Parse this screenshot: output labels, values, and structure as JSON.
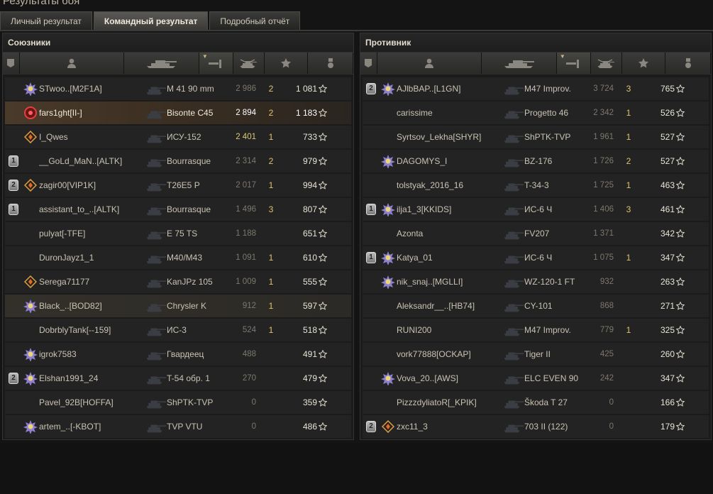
{
  "window": {
    "title": "Результаты боя"
  },
  "tabs": [
    {
      "label": "Личный результат",
      "active": false
    },
    {
      "label": "Командный результат",
      "active": true
    },
    {
      "label": "Подробный отчёт",
      "active": false
    }
  ],
  "teams": {
    "allies": {
      "title": "Союзники",
      "rows": [
        {
          "platoon": "",
          "icon": "medal-icon",
          "name": "STwoo..[M2F1A]",
          "vehicle": "M 41 90 mm",
          "damage": "2 986",
          "kills": "2",
          "xp": "1 081",
          "highlight": "",
          "dmg_hi": false
        },
        {
          "platoon": "",
          "icon": "clan-emblem-icon",
          "name": "fars1ght[II-]",
          "vehicle": "Bisonte C45",
          "damage": "2 894",
          "kills": "2",
          "xp": "1 183",
          "highlight": "self",
          "dmg_hi": true
        },
        {
          "platoon": "",
          "icon": "rank-icon",
          "name": "I_Qwes",
          "vehicle": "ИСУ-152",
          "damage": "2 401",
          "kills": "1",
          "xp": "733",
          "highlight": "",
          "dmg_hi": true
        },
        {
          "platoon": "1",
          "icon": "",
          "name": "__GoLd_MaN..[ALTK]",
          "vehicle": "Bourrasque",
          "damage": "2 314",
          "kills": "2",
          "xp": "979",
          "highlight": "",
          "dmg_hi": false
        },
        {
          "platoon": "2",
          "icon": "rank-icon",
          "name": "zagir00[VIP1K]",
          "vehicle": "T26E5 P",
          "damage": "2 017",
          "kills": "1",
          "xp": "994",
          "highlight": "",
          "dmg_hi": false
        },
        {
          "platoon": "1",
          "icon": "",
          "name": "assistant_to_..[ALTK]",
          "vehicle": "Bourrasque",
          "damage": "1 496",
          "kills": "3",
          "xp": "807",
          "highlight": "",
          "dmg_hi": false
        },
        {
          "platoon": "",
          "icon": "",
          "name": "pulyat[-TFE]",
          "vehicle": "E 75 TS",
          "damage": "1 188",
          "kills": "",
          "xp": "651",
          "highlight": "",
          "dmg_hi": false
        },
        {
          "platoon": "",
          "icon": "",
          "name": "DuronJayz1_1",
          "vehicle": "M40/M43",
          "damage": "1 091",
          "kills": "1",
          "xp": "610",
          "highlight": "",
          "dmg_hi": false
        },
        {
          "platoon": "",
          "icon": "rank-icon",
          "name": "Serega71177",
          "vehicle": "KanJPz 105",
          "damage": "1 009",
          "kills": "1",
          "xp": "555",
          "highlight": "",
          "dmg_hi": false
        },
        {
          "platoon": "",
          "icon": "medal-icon",
          "name": "Black_..[BOD82]",
          "vehicle": "Chrysler K",
          "damage": "912",
          "kills": "1",
          "xp": "597",
          "highlight": "platoon",
          "dmg_hi": false
        },
        {
          "platoon": "",
          "icon": "",
          "name": "DobrblyTank[--159]",
          "vehicle": "ИС-3",
          "damage": "524",
          "kills": "1",
          "xp": "518",
          "highlight": "",
          "dmg_hi": false
        },
        {
          "platoon": "",
          "icon": "medal-icon",
          "name": "igrok7583",
          "vehicle": "Гвардеец",
          "damage": "488",
          "kills": "",
          "xp": "491",
          "highlight": "",
          "dmg_hi": false
        },
        {
          "platoon": "2",
          "icon": "medal-icon",
          "name": "Elshan1991_24",
          "vehicle": "T-54 обр. 1",
          "damage": "270",
          "kills": "",
          "xp": "479",
          "highlight": "",
          "dmg_hi": false
        },
        {
          "platoon": "",
          "icon": "",
          "name": "Pavel_92B[HOFFA]",
          "vehicle": "ShPTK-TVP",
          "damage": "0",
          "kills": "",
          "xp": "359",
          "highlight": "",
          "dmg_hi": false
        },
        {
          "platoon": "",
          "icon": "medal-icon",
          "name": "artem_..[-KBOT]",
          "vehicle": "TVP VTU",
          "damage": "0",
          "kills": "",
          "xp": "486",
          "highlight": "",
          "dmg_hi": false
        }
      ]
    },
    "enemies": {
      "title": "Противник",
      "rows": [
        {
          "platoon": "2",
          "icon": "medal-icon",
          "name": "AJlbBAP..[L1GN]",
          "vehicle": "M47 Improv.",
          "damage": "3 724",
          "kills": "3",
          "xp": "765",
          "highlight": "",
          "dmg_hi": false
        },
        {
          "platoon": "",
          "icon": "",
          "name": "carissime",
          "vehicle": "Progetto 46",
          "damage": "2 342",
          "kills": "1",
          "xp": "526",
          "highlight": "",
          "dmg_hi": false
        },
        {
          "platoon": "",
          "icon": "",
          "name": "Syrtsov_Lekha[SHYR]",
          "vehicle": "ShPTK-TVP",
          "damage": "1 961",
          "kills": "1",
          "xp": "527",
          "highlight": "",
          "dmg_hi": false
        },
        {
          "platoon": "",
          "icon": "medal-icon",
          "name": "DAGOMYS_I",
          "vehicle": "BZ-176",
          "damage": "1 726",
          "kills": "2",
          "xp": "527",
          "highlight": "",
          "dmg_hi": false
        },
        {
          "platoon": "",
          "icon": "",
          "name": "tolstyak_2016_16",
          "vehicle": "T-34-3",
          "damage": "1 725",
          "kills": "1",
          "xp": "463",
          "highlight": "",
          "dmg_hi": false
        },
        {
          "platoon": "1",
          "icon": "medal-icon",
          "name": "ilja1_3[KKIDS]",
          "vehicle": "ИС-6 Ч",
          "damage": "1 406",
          "kills": "3",
          "xp": "461",
          "highlight": "",
          "dmg_hi": false
        },
        {
          "platoon": "",
          "icon": "",
          "name": "Azonta",
          "vehicle": "FV207",
          "damage": "1 371",
          "kills": "",
          "xp": "342",
          "highlight": "",
          "dmg_hi": false
        },
        {
          "platoon": "1",
          "icon": "medal-icon",
          "name": "Katya_01",
          "vehicle": "ИС-6 Ч",
          "damage": "1 075",
          "kills": "1",
          "xp": "347",
          "highlight": "",
          "dmg_hi": false
        },
        {
          "platoon": "",
          "icon": "medal-icon",
          "name": "nik_snaj..[MGLLI]",
          "vehicle": "WZ-120-1 FT",
          "damage": "932",
          "kills": "",
          "xp": "263",
          "highlight": "",
          "dmg_hi": false
        },
        {
          "platoon": "",
          "icon": "",
          "name": "Aleksandr__..[HB74]",
          "vehicle": "CY-101",
          "damage": "868",
          "kills": "",
          "xp": "271",
          "highlight": "",
          "dmg_hi": false
        },
        {
          "platoon": "",
          "icon": "",
          "name": "RUNI200",
          "vehicle": "M47 Improv.",
          "damage": "779",
          "kills": "1",
          "xp": "325",
          "highlight": "",
          "dmg_hi": false
        },
        {
          "platoon": "",
          "icon": "",
          "name": "vork77888[OCKAP]",
          "vehicle": "Tiger II",
          "damage": "425",
          "kills": "",
          "xp": "260",
          "highlight": "",
          "dmg_hi": false
        },
        {
          "platoon": "",
          "icon": "medal-icon",
          "name": "Vova_20..[AWS]",
          "vehicle": "ELC EVEN 90",
          "damage": "242",
          "kills": "",
          "xp": "347",
          "highlight": "",
          "dmg_hi": false
        },
        {
          "platoon": "",
          "icon": "",
          "name": "PizzzdyliatoR[_KPIK]",
          "vehicle": "Škoda T 27",
          "damage": "0",
          "kills": "",
          "xp": "166",
          "highlight": "",
          "dmg_hi": false
        },
        {
          "platoon": "2",
          "icon": "rank-icon",
          "name": "zxc11_3",
          "vehicle": "703 II (122)",
          "damage": "0",
          "kills": "",
          "xp": "179",
          "highlight": "",
          "dmg_hi": false
        }
      ]
    }
  },
  "columns": [
    "badge-icon",
    "player-icon",
    "vehicle-icon",
    "damage-icon",
    "kills-icon",
    "xp-star-icon",
    "medal-column-icon"
  ]
}
